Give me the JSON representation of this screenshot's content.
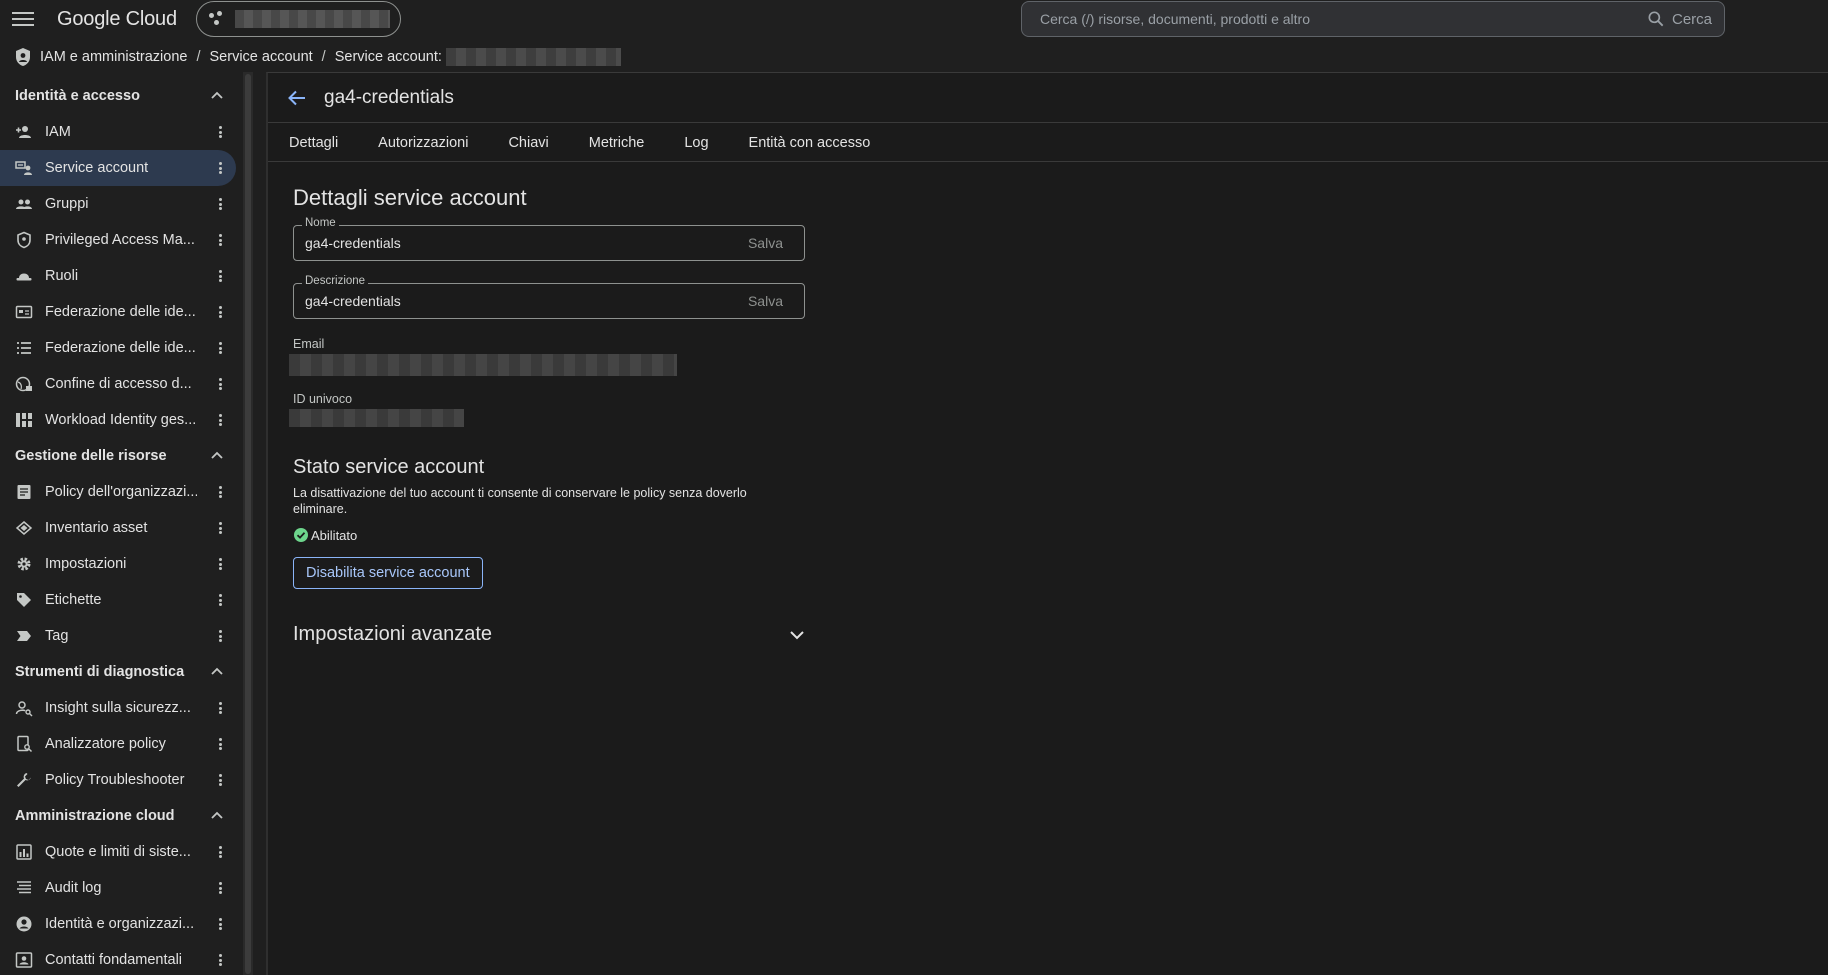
{
  "app": {
    "brand": "Google Cloud",
    "search_placeholder": "Cerca (/) risorse, documenti, prodotti e altro",
    "search_button": "Cerca"
  },
  "breadcrumb": {
    "items": [
      "IAM e amministrazione",
      "Service account",
      "Service account:"
    ]
  },
  "sidebar": {
    "sections": [
      {
        "title": "Identità e accesso",
        "items": [
          {
            "label": "IAM",
            "icon": "person-add-icon"
          },
          {
            "label": "Service account",
            "icon": "service-account-icon",
            "active": true
          },
          {
            "label": "Gruppi",
            "icon": "group-icon"
          },
          {
            "label": "Privileged Access Ma...",
            "icon": "shield-icon"
          },
          {
            "label": "Ruoli",
            "icon": "hat-icon"
          },
          {
            "label": "Federazione delle ide...",
            "icon": "id-card-icon"
          },
          {
            "label": "Federazione delle ide...",
            "icon": "list-icon"
          },
          {
            "label": "Confine di accesso d...",
            "icon": "globe-lock-icon"
          },
          {
            "label": "Workload Identity ges...",
            "icon": "grid-icon"
          }
        ]
      },
      {
        "title": "Gestione delle risorse",
        "items": [
          {
            "label": "Policy dell'organizzazi...",
            "icon": "document-icon"
          },
          {
            "label": "Inventario asset",
            "icon": "layers-icon"
          },
          {
            "label": "Impostazioni",
            "icon": "gear-icon"
          },
          {
            "label": "Etichette",
            "icon": "label-icon"
          },
          {
            "label": "Tag",
            "icon": "tag-icon"
          }
        ]
      },
      {
        "title": "Strumenti di diagnostica",
        "items": [
          {
            "label": "Insight sulla sicurezz...",
            "icon": "person-search-icon"
          },
          {
            "label": "Analizzatore policy",
            "icon": "policy-search-icon"
          },
          {
            "label": "Policy Troubleshooter",
            "icon": "wrench-icon"
          }
        ]
      },
      {
        "title": "Amministrazione cloud",
        "items": [
          {
            "label": "Quote e limiti di siste...",
            "icon": "quota-icon"
          },
          {
            "label": "Audit log",
            "icon": "lines-icon"
          },
          {
            "label": "Identità e organizzazi...",
            "icon": "account-circle-icon"
          },
          {
            "label": "Contatti fondamentali",
            "icon": "contact-icon"
          }
        ]
      }
    ]
  },
  "main": {
    "title": "ga4-credentials",
    "tabs": [
      "Dettagli",
      "Autorizzazioni",
      "Chiavi",
      "Metriche",
      "Log",
      "Entità con accesso"
    ],
    "details_title": "Dettagli service account",
    "name_label": "Nome",
    "name_value": "ga4-credentials",
    "description_label": "Descrizione",
    "description_value": "ga4-credentials",
    "save_label": "Salva",
    "email_label": "Email",
    "unique_id_label": "ID univoco",
    "status_title": "Stato service account",
    "status_desc": "La disattivazione del tuo account ti consente di conservare le policy senza doverlo eliminare.",
    "status_value": "Abilitato",
    "disable_button": "Disabilita service account",
    "advanced_title": "Impostazioni avanzate"
  },
  "colors": {
    "accent": "#8ab4f8",
    "active_bg": "#2d3a4f",
    "status_ok": "#6dd58c"
  }
}
